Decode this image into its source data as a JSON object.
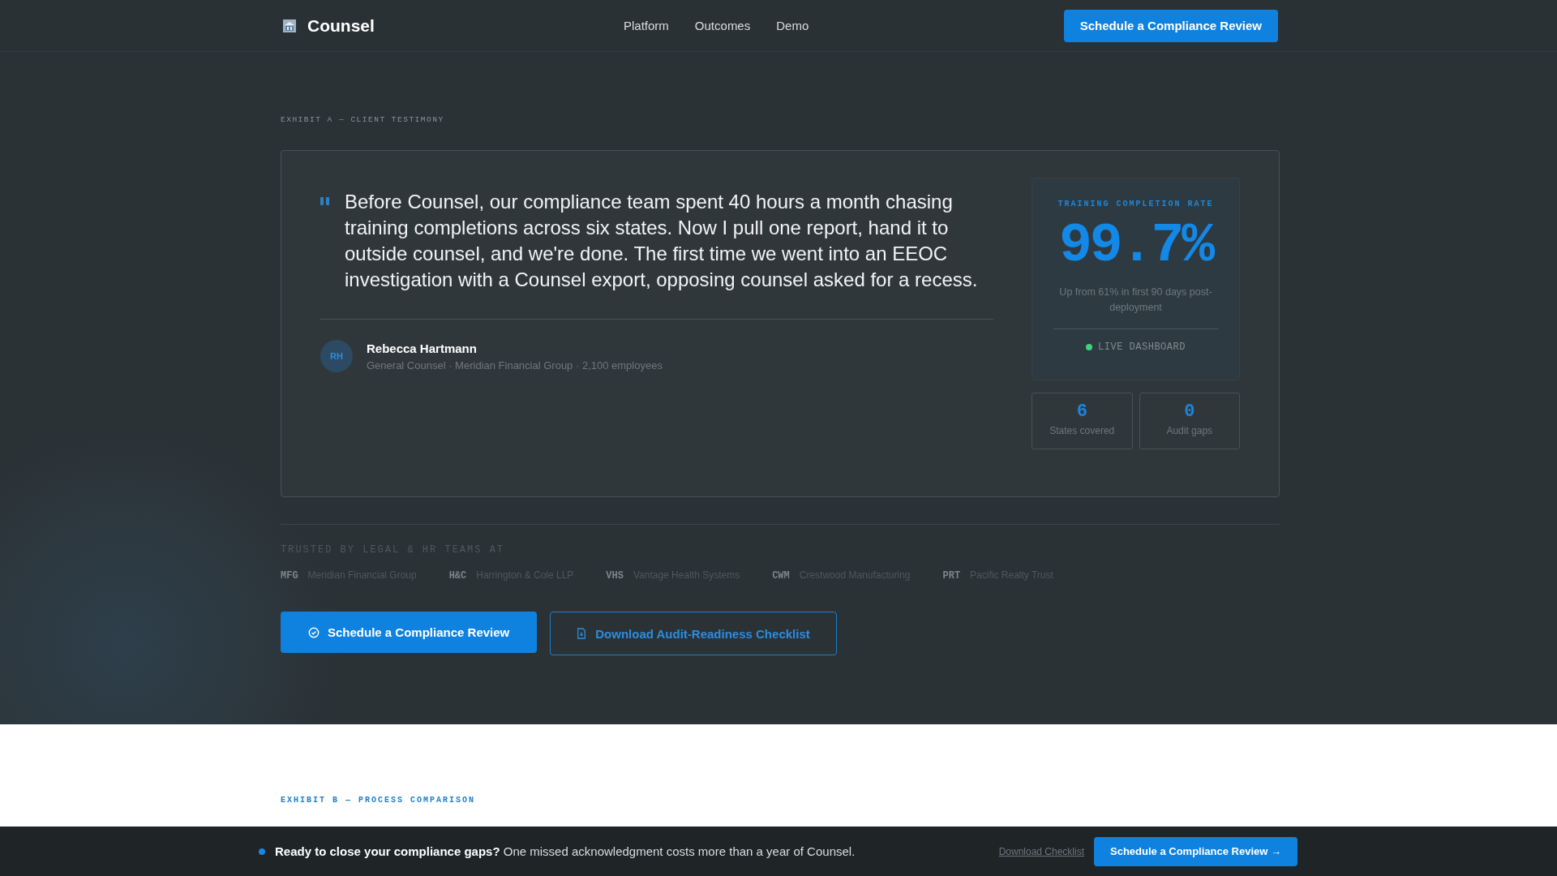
{
  "nav": {
    "brand": "Counsel",
    "links": [
      "Platform",
      "Outcomes",
      "Demo"
    ],
    "cta": "Schedule a Compliance Review"
  },
  "exhibit_a": {
    "label": "EXHIBIT A — CLIENT TESTIMONY",
    "quote": "Before Counsel, our compliance team spent 40 hours a month chasing training completions across six states. Now I pull one report, hand it to outside counsel, and we're done. The first time we went into an EEOC investigation with a Counsel export, opposing counsel asked for a recess.",
    "author": {
      "initials": "RH",
      "name": "Rebecca Hartmann",
      "role": "General Counsel · Meridian Financial Group · 2,100 employees"
    },
    "stat": {
      "label": "TRAINING COMPLETION RATE",
      "value": "99.7%",
      "note": "Up from 61% in first 90 days post-deployment",
      "live": true,
      "live_label": "LIVE DASHBOARD"
    },
    "mini_stats": [
      {
        "value": "6",
        "label": "States covered"
      },
      {
        "value": "0",
        "label": "Audit gaps"
      }
    ]
  },
  "trusted": {
    "label": "TRUSTED BY LEGAL & HR TEAMS AT",
    "clients": [
      {
        "abbr": "MFG",
        "name": "Meridian Financial Group"
      },
      {
        "abbr": "H&C",
        "name": "Harrington & Cole LLP"
      },
      {
        "abbr": "VHS",
        "name": "Vantage Health Systems"
      },
      {
        "abbr": "CWM",
        "name": "Crestwood Manufacturing"
      },
      {
        "abbr": "PRT",
        "name": "Pacific Realty Trust"
      }
    ]
  },
  "actions": {
    "primary": "Schedule a Compliance Review",
    "secondary": "Download Audit-Readiness Checklist"
  },
  "exhibit_b": {
    "label": "EXHIBIT B — PROCESS COMPARISON"
  },
  "sticky_bar": {
    "lead": "**Ready to close your compliance gaps?** One missed acknowledgment costs more than a year of Counsel.",
    "link": "Download Checklist",
    "cta": "Schedule a Compliance Review →"
  }
}
